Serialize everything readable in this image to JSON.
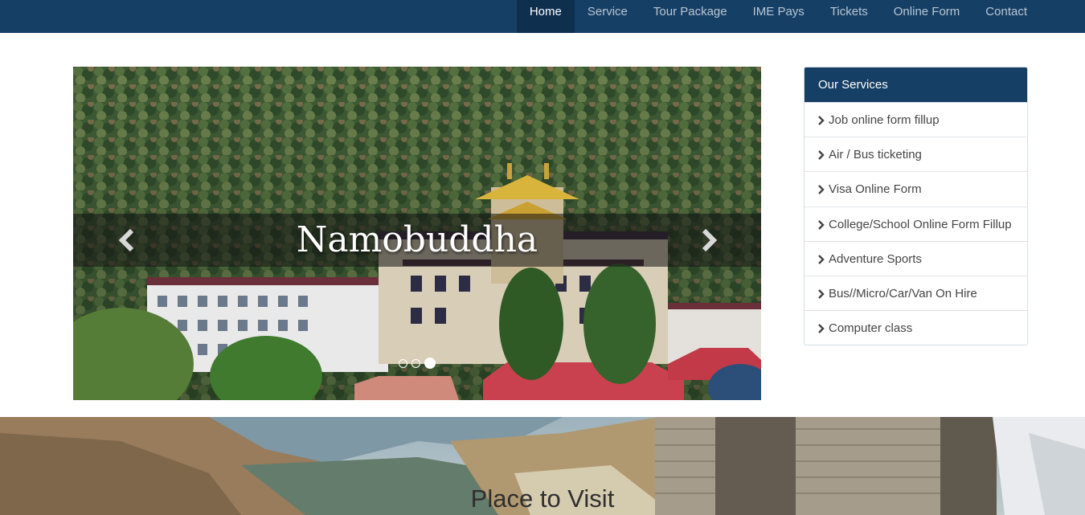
{
  "nav": {
    "items": [
      {
        "label": "Home",
        "active": true
      },
      {
        "label": "Service"
      },
      {
        "label": "Tour Package"
      },
      {
        "label": "IME Pays"
      },
      {
        "label": "Tickets"
      },
      {
        "label": "Online Form"
      },
      {
        "label": "Contact"
      }
    ]
  },
  "carousel": {
    "caption": "Namobuddha",
    "prev_icon": "chevron-left-icon",
    "next_icon": "chevron-right-icon",
    "indicators": 3,
    "active_index": 2
  },
  "services": {
    "title": "Our Services",
    "items": [
      "Job online form fillup",
      "Air / Bus ticketing",
      "Visa Online Form",
      "College/School Online Form Fillup",
      "Adventure Sports",
      "Bus//Micro/Car/Van On Hire",
      "Computer class"
    ]
  },
  "banner": {
    "title": "Place to Visit"
  },
  "colors": {
    "navbar": "#163f65",
    "nav_active": "#0f2f4f",
    "panel_header": "#163f65"
  }
}
